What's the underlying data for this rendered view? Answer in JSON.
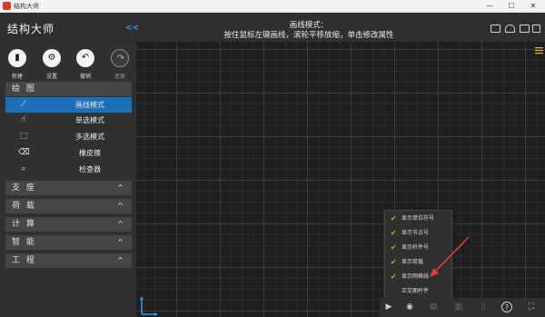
{
  "window": {
    "title": "结构大师",
    "minimize": "—",
    "maximize": "☐",
    "close": "✕"
  },
  "header": {
    "brand": "结构大师",
    "collapse": "<<",
    "hint_line1": "画线模式：",
    "hint_line2": "按住鼠标左键画线，滚轮平移放缩，单击修改属性"
  },
  "toolbar": [
    {
      "label": "新建",
      "icon": "new-file-icon",
      "glyph": "▮",
      "enabled": true
    },
    {
      "label": "设置",
      "icon": "settings-icon",
      "glyph": "⚙",
      "enabled": true
    },
    {
      "label": "撤销",
      "icon": "undo-icon",
      "glyph": "↶",
      "enabled": true
    },
    {
      "label": "还原",
      "icon": "redo-icon",
      "glyph": "↷",
      "enabled": false
    }
  ],
  "sidebar": {
    "draw_section": "绘 图",
    "modes": [
      {
        "label": "画线模式",
        "icon": "line-tool-icon",
        "glyph": "⟋",
        "active": true
      },
      {
        "label": "单选模式",
        "icon": "pointer-icon",
        "glyph": "☝",
        "active": false
      },
      {
        "label": "多选模式",
        "icon": "multi-select-icon",
        "glyph": "⬚",
        "active": false
      },
      {
        "label": "橡皮擦",
        "icon": "eraser-icon",
        "glyph": "⌫",
        "active": false
      },
      {
        "label": "检查器",
        "icon": "inspector-icon",
        "glyph": "⌕",
        "active": false
      }
    ],
    "sections": [
      {
        "label": "支 座",
        "caret": "^"
      },
      {
        "label": "荷 载",
        "caret": "^"
      },
      {
        "label": "计 算",
        "caret": "^"
      },
      {
        "label": "智 能",
        "caret": "^"
      },
      {
        "label": "工 程",
        "caret": "^"
      }
    ]
  },
  "display_options": [
    {
      "label": "显示单位符号",
      "checked": true
    },
    {
      "label": "显示节点号",
      "checked": true
    },
    {
      "label": "显示杆件号",
      "checked": true
    },
    {
      "label": "显示荷载",
      "checked": true
    },
    {
      "label": "显示网格线",
      "checked": true
    },
    {
      "label": "正交面杆件",
      "checked": false
    }
  ],
  "bottom_icons": [
    "play-icon",
    "eye-icon",
    "copy-icon",
    "paste-icon",
    "delete-icon",
    "help-icon",
    "fit-screen-icon"
  ],
  "colors": {
    "accent": "#1a6fb6",
    "check": "#8ac640",
    "arrow": "#e53935",
    "link": "#2e9cf0"
  }
}
